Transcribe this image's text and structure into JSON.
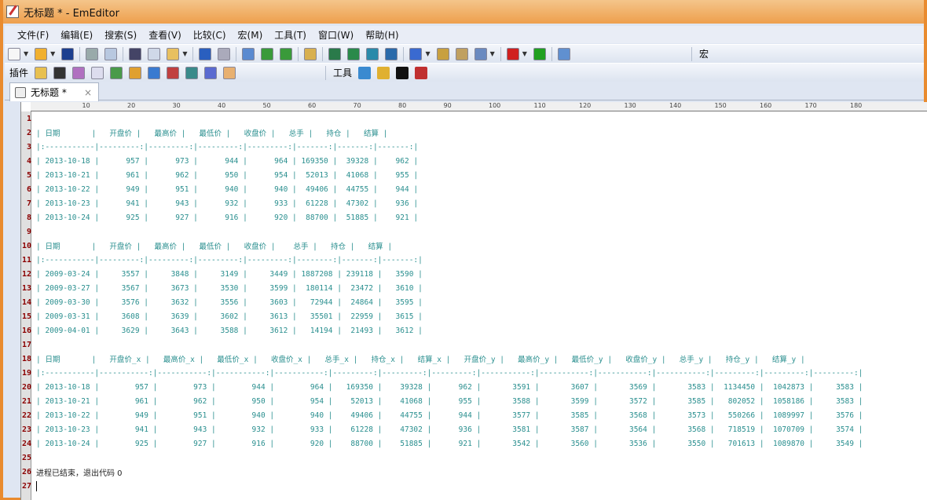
{
  "window": {
    "title": "无标题 * - EmEditor"
  },
  "menu": [
    "文件(F)",
    "编辑(E)",
    "搜索(S)",
    "查看(V)",
    "比较(C)",
    "宏(M)",
    "工具(T)",
    "窗口(W)",
    "帮助(H)"
  ],
  "toolbar": {
    "macro_label": "宏",
    "plugins_label": "插件",
    "tools_label": "工具",
    "icons": [
      "new-file-icon",
      "open-file-icon",
      "save-icon",
      "print-icon",
      "print-preview-icon",
      "cut-icon",
      "copy-icon",
      "paste-icon",
      "undo-icon",
      "redo-icon",
      "find-icon",
      "find-next-icon",
      "find-prev-icon",
      "find-in-files-icon",
      "word-wrap-icon",
      "wrap-window-icon",
      "wrap-page-icon",
      "wrap-marker-icon",
      "charset-icon",
      "config-icon",
      "properties-icon",
      "checklist-icon",
      "record-macro-icon",
      "run-macro-icon",
      "plugin-icon"
    ],
    "plugin_icons": [
      "explorer-icon",
      "binoculars-icon",
      "html-bar-icon",
      "outline-icon",
      "projects-icon",
      "snippets-icon",
      "comment-icon",
      "spell-icon",
      "web-preview-icon",
      "word-count-icon",
      "hand-icon"
    ],
    "tool_icons": [
      "internet-explorer-icon",
      "export-icon",
      "command-prompt-icon",
      "hammer-icon"
    ]
  },
  "tab": {
    "label": "无标题 *",
    "close": "×"
  },
  "ruler": [
    "10",
    "20",
    "30",
    "40",
    "50",
    "60",
    "70",
    "80",
    "90",
    "100",
    "110",
    "120",
    "130",
    "140",
    "150",
    "160",
    "170",
    "180"
  ],
  "lines": [
    "",
    "| 日期       |   开盘价 |   最高价 |   最低价 |   收盘价 |   总手 |   持仓 |   结算 |",
    "|:-----------|---------:|---------:|---------:|---------:|-------:|-------:|-------:|",
    "| 2013-10-18 |      957 |      973 |      944 |      964 | 169350 |  39328 |    962 |",
    "| 2013-10-21 |      961 |      962 |      950 |      954 |  52013 |  41068 |    955 |",
    "| 2013-10-22 |      949 |      951 |      940 |      940 |  49406 |  44755 |    944 |",
    "| 2013-10-23 |      941 |      943 |      932 |      933 |  61228 |  47302 |    936 |",
    "| 2013-10-24 |      925 |      927 |      916 |      920 |  88700 |  51885 |    921 |",
    "",
    "| 日期       |   开盘价 |   最高价 |   最低价 |   收盘价 |    总手 |   持仓 |   结算 |",
    "|:-----------|---------:|---------:|---------:|---------:|--------:|-------:|-------:|",
    "| 2009-03-24 |     3557 |     3848 |     3149 |     3449 | 1887208 | 239118 |   3590 |",
    "| 2009-03-27 |     3567 |     3673 |     3530 |     3599 |  180114 |  23472 |   3610 |",
    "| 2009-03-30 |     3576 |     3632 |     3556 |     3603 |   72944 |  24864 |   3595 |",
    "| 2009-03-31 |     3608 |     3639 |     3602 |     3613 |   35501 |  22959 |   3615 |",
    "| 2009-04-01 |     3629 |     3643 |     3588 |     3612 |   14194 |  21493 |   3612 |",
    "",
    "| 日期       |   开盘价_x |   最高价_x |   最低价_x |   收盘价_x |   总手_x |   持仓_x |   结算_x |   开盘价_y |   最高价_y |   最低价_y |   收盘价_y |   总手_y |   持仓_y |   结算_y |",
    "|:-----------|-----------:|-----------:|-----------:|-----------:|---------:|---------:|---------:|-----------:|-----------:|-----------:|-----------:|---------:|---------:|---------:|",
    "| 2013-10-18 |        957 |        973 |        944 |        964 |   169350 |    39328 |      962 |       3591 |       3607 |       3569 |       3583 |  1134450 |  1042873 |     3583 |",
    "| 2013-10-21 |        961 |        962 |        950 |        954 |    52013 |    41068 |      955 |       3588 |       3599 |       3572 |       3585 |   802052 |  1058186 |     3583 |",
    "| 2013-10-22 |        949 |        951 |        940 |        940 |    49406 |    44755 |      944 |       3577 |       3585 |       3568 |       3573 |   550266 |  1089997 |     3576 |",
    "| 2013-10-23 |        941 |        943 |        932 |        933 |    61228 |    47302 |      936 |       3581 |       3587 |       3564 |       3568 |   718519 |  1070709 |     3574 |",
    "| 2013-10-24 |        925 |        927 |        916 |        920 |    88700 |    51885 |      921 |       3542 |       3560 |       3536 |       3550 |   701613 |  1089870 |     3549 |",
    "",
    "进程已结束，退出代码 0",
    ""
  ]
}
